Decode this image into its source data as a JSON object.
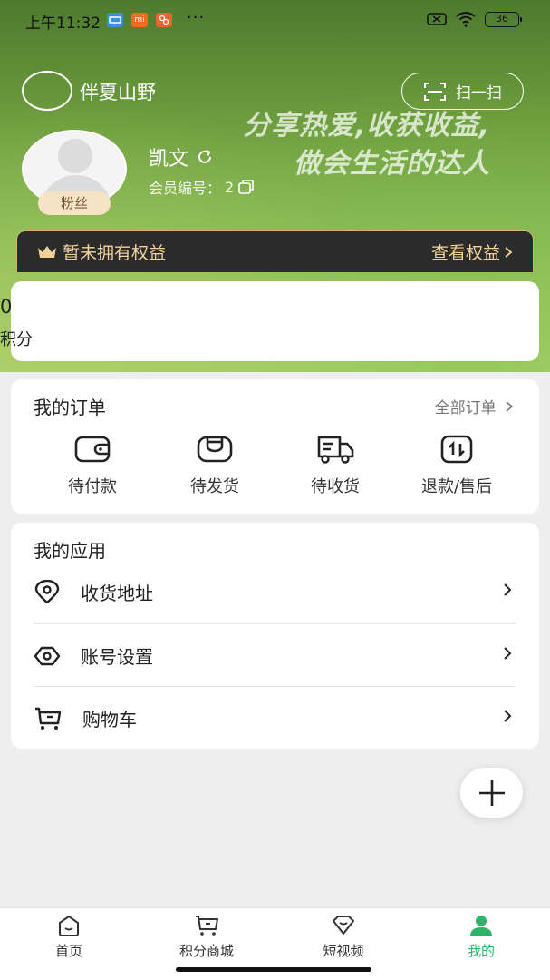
{
  "status_bar": {
    "time": "上午11:32",
    "app_icons": [
      "wallet-app-icon",
      "mi-app-icon",
      "orange-app-icon"
    ],
    "mi_icon_text": "mi",
    "dots": "···",
    "battery": "36",
    "colors": {
      "wallet": "#3f8fe0",
      "mi": "#f26a1b",
      "orange": "#f0622f"
    }
  },
  "header": {
    "brand_name": "伴夏山野",
    "scan_label": "扫一扫",
    "slogan_line1": "分享热爱,收获收益,",
    "slogan_line2": "做会生活的达人"
  },
  "profile": {
    "nickname": "凯文",
    "member_label": "会员编号：",
    "member_no": "2",
    "fans_badge": "粉丝"
  },
  "rights": {
    "status": "暂未拥有权益",
    "view_label": "查看权益"
  },
  "points": {
    "value": "0",
    "label": "积分"
  },
  "orders": {
    "title": "我的订单",
    "all_label": "全部订单",
    "items": [
      {
        "label": "待付款",
        "icon": "wallet-icon"
      },
      {
        "label": "待发货",
        "icon": "package-icon"
      },
      {
        "label": "待收货",
        "icon": "truck-icon"
      },
      {
        "label": "退款/售后",
        "icon": "refund-icon"
      }
    ]
  },
  "apps": {
    "title": "我的应用",
    "items": [
      {
        "label": "收货地址",
        "icon": "location-icon"
      },
      {
        "label": "账号设置",
        "icon": "eye-icon"
      },
      {
        "label": "购物车",
        "icon": "cart-icon"
      }
    ]
  },
  "tabbar": {
    "accent": "#2eb36a",
    "items": [
      {
        "label": "首页",
        "icon": "home-icon"
      },
      {
        "label": "积分商城",
        "icon": "cart-icon"
      },
      {
        "label": "短视频",
        "icon": "diamond-icon"
      },
      {
        "label": "我的",
        "icon": "user-icon",
        "active": true
      }
    ]
  }
}
